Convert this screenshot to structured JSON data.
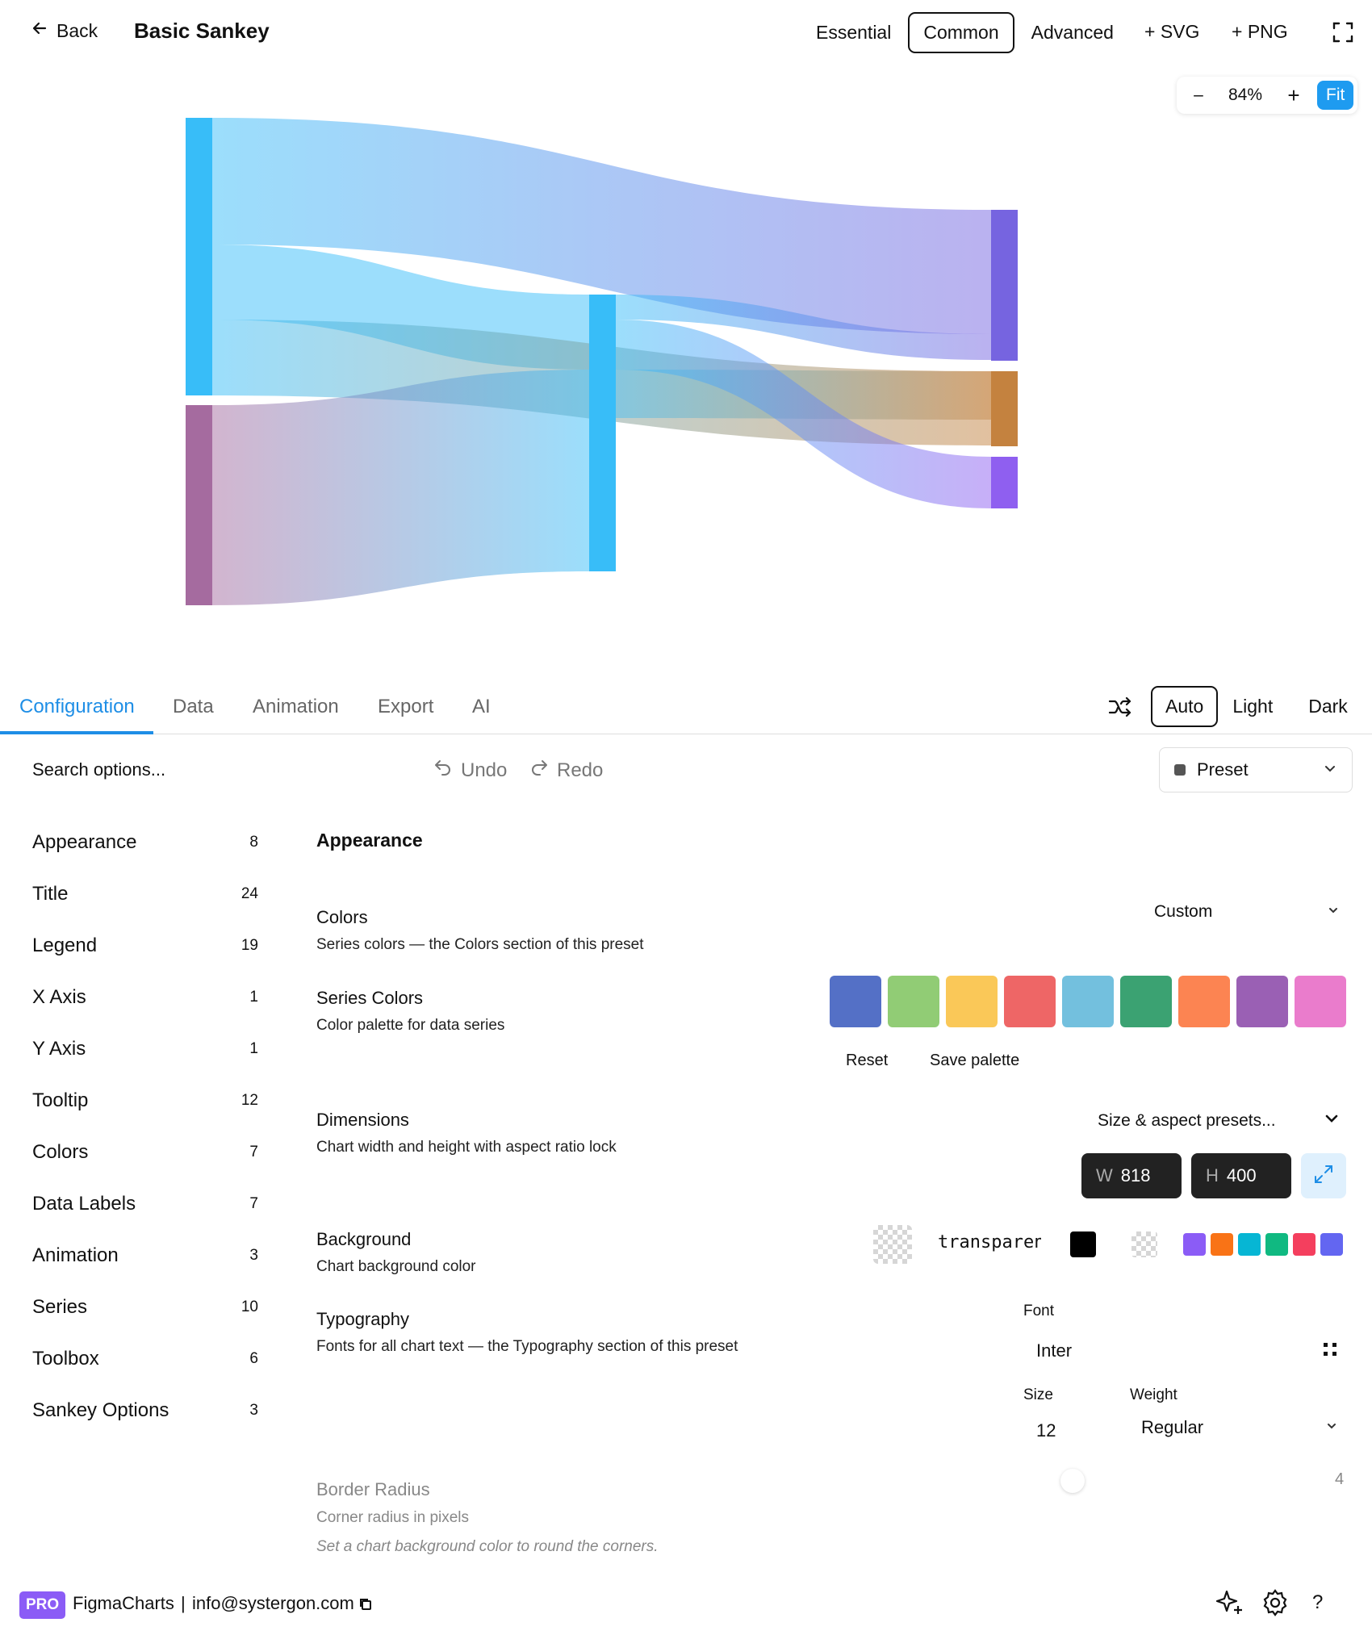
{
  "header": {
    "back_label": "Back",
    "title": "Basic Sankey",
    "modes": [
      "Essential",
      "Common",
      "Advanced"
    ],
    "active_mode": "Common",
    "export_svg": "+ SVG",
    "export_png": "+ PNG"
  },
  "zoom": {
    "minus": "–",
    "level": "84%",
    "plus": "+",
    "fit": "Fit"
  },
  "chart_data": {
    "type": "sankey",
    "nodes": [
      {
        "id": "source-a",
        "column": 0,
        "color": "#38bdf8"
      },
      {
        "id": "source-b",
        "column": 0,
        "color": "#a56b9f"
      },
      {
        "id": "middle",
        "column": 1,
        "color": "#38bdf8"
      },
      {
        "id": "target-a",
        "column": 2,
        "color": "#7664e0"
      },
      {
        "id": "target-b",
        "column": 2,
        "color": "#c4823f"
      },
      {
        "id": "target-c",
        "column": 2,
        "color": "#8f5ff0"
      }
    ],
    "links": [
      {
        "source": "source-a",
        "target": "target-a",
        "value": 47
      },
      {
        "source": "source-a",
        "target": "middle",
        "value": 28
      },
      {
        "source": "source-a",
        "target": "target-b",
        "value": 28
      },
      {
        "source": "source-b",
        "target": "middle",
        "value": 75
      },
      {
        "source": "middle",
        "target": "target-a",
        "value": 9
      },
      {
        "source": "middle",
        "target": "target-b",
        "value": 57
      },
      {
        "source": "middle",
        "target": "target-c",
        "value": 37
      }
    ]
  },
  "tabs": [
    "Configuration",
    "Data",
    "Animation",
    "Export",
    "AI"
  ],
  "active_tab": "Configuration",
  "themes": [
    "Auto",
    "Light",
    "Dark"
  ],
  "active_theme": "Auto",
  "toolbar": {
    "search_placeholder": "Search options...",
    "undo": "Undo",
    "redo": "Redo",
    "preset": "Preset"
  },
  "categories": [
    {
      "label": "Appearance",
      "count": "8"
    },
    {
      "label": "Title",
      "count": "24"
    },
    {
      "label": "Legend",
      "count": "19"
    },
    {
      "label": "X Axis",
      "count": "1"
    },
    {
      "label": "Y Axis",
      "count": "1"
    },
    {
      "label": "Tooltip",
      "count": "12"
    },
    {
      "label": "Colors",
      "count": "7"
    },
    {
      "label": "Data Labels",
      "count": "7"
    },
    {
      "label": "Animation",
      "count": "3"
    },
    {
      "label": "Series",
      "count": "10"
    },
    {
      "label": "Toolbox",
      "count": "6"
    },
    {
      "label": "Sankey Options",
      "count": "3"
    }
  ],
  "panel": {
    "heading": "Appearance",
    "colors": {
      "title": "Colors",
      "desc": "Series colors — the Colors section of this preset",
      "value": "Custom"
    },
    "series_colors": {
      "title": "Series Colors",
      "desc": "Color palette for data series",
      "palette": [
        "#5470c6",
        "#91cc75",
        "#fac858",
        "#ee6666",
        "#73c0de",
        "#3ba272",
        "#fc8452",
        "#9a60b4",
        "#ea7ccc"
      ],
      "reset": "Reset",
      "save": "Save palette"
    },
    "dimensions": {
      "title": "Dimensions",
      "desc": "Chart width and height with aspect ratio lock",
      "presets": "Size & aspect presets...",
      "w_label": "W",
      "w": "818",
      "h_label": "H",
      "h": "400"
    },
    "background": {
      "title": "Background",
      "desc": "Chart background color",
      "value": "transparent",
      "quick_colors": [
        "#8b5cf6",
        "#f97316",
        "#06b6d4",
        "#10b981",
        "#f43f5e",
        "#6366f1"
      ]
    },
    "typography": {
      "title": "Typography",
      "desc": "Fonts for all chart text — the Typography section of this preset",
      "font_label": "Font",
      "font": "Inter",
      "size_label": "Size",
      "size": "12",
      "weight_label": "Weight",
      "weight": "Regular"
    },
    "border_radius": {
      "title": "Border Radius",
      "desc": "Corner radius in pixels",
      "note": "Set a chart background color to round the corners.",
      "value": "4"
    }
  },
  "footer": {
    "badge": "PRO",
    "brand": "FigmaCharts",
    "separator": "|",
    "email": "info@systergon.com",
    "help": "?"
  }
}
